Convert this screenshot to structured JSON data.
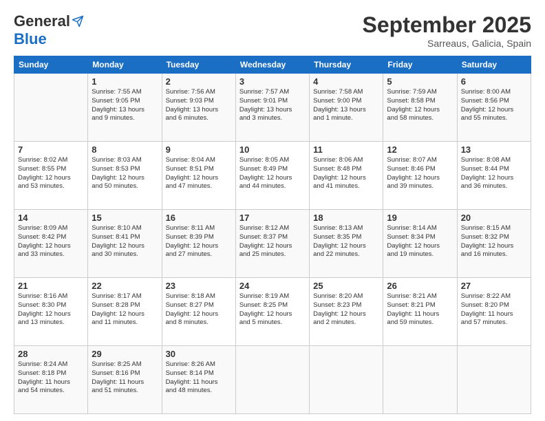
{
  "header": {
    "logo_general": "General",
    "logo_blue": "Blue",
    "month_title": "September 2025",
    "location": "Sarreaus, Galicia, Spain"
  },
  "weekdays": [
    "Sunday",
    "Monday",
    "Tuesday",
    "Wednesday",
    "Thursday",
    "Friday",
    "Saturday"
  ],
  "weeks": [
    [
      {
        "day": "",
        "info": ""
      },
      {
        "day": "1",
        "info": "Sunrise: 7:55 AM\nSunset: 9:05 PM\nDaylight: 13 hours\nand 9 minutes."
      },
      {
        "day": "2",
        "info": "Sunrise: 7:56 AM\nSunset: 9:03 PM\nDaylight: 13 hours\nand 6 minutes."
      },
      {
        "day": "3",
        "info": "Sunrise: 7:57 AM\nSunset: 9:01 PM\nDaylight: 13 hours\nand 3 minutes."
      },
      {
        "day": "4",
        "info": "Sunrise: 7:58 AM\nSunset: 9:00 PM\nDaylight: 13 hours\nand 1 minute."
      },
      {
        "day": "5",
        "info": "Sunrise: 7:59 AM\nSunset: 8:58 PM\nDaylight: 12 hours\nand 58 minutes."
      },
      {
        "day": "6",
        "info": "Sunrise: 8:00 AM\nSunset: 8:56 PM\nDaylight: 12 hours\nand 55 minutes."
      }
    ],
    [
      {
        "day": "7",
        "info": "Sunrise: 8:02 AM\nSunset: 8:55 PM\nDaylight: 12 hours\nand 53 minutes."
      },
      {
        "day": "8",
        "info": "Sunrise: 8:03 AM\nSunset: 8:53 PM\nDaylight: 12 hours\nand 50 minutes."
      },
      {
        "day": "9",
        "info": "Sunrise: 8:04 AM\nSunset: 8:51 PM\nDaylight: 12 hours\nand 47 minutes."
      },
      {
        "day": "10",
        "info": "Sunrise: 8:05 AM\nSunset: 8:49 PM\nDaylight: 12 hours\nand 44 minutes."
      },
      {
        "day": "11",
        "info": "Sunrise: 8:06 AM\nSunset: 8:48 PM\nDaylight: 12 hours\nand 41 minutes."
      },
      {
        "day": "12",
        "info": "Sunrise: 8:07 AM\nSunset: 8:46 PM\nDaylight: 12 hours\nand 39 minutes."
      },
      {
        "day": "13",
        "info": "Sunrise: 8:08 AM\nSunset: 8:44 PM\nDaylight: 12 hours\nand 36 minutes."
      }
    ],
    [
      {
        "day": "14",
        "info": "Sunrise: 8:09 AM\nSunset: 8:42 PM\nDaylight: 12 hours\nand 33 minutes."
      },
      {
        "day": "15",
        "info": "Sunrise: 8:10 AM\nSunset: 8:41 PM\nDaylight: 12 hours\nand 30 minutes."
      },
      {
        "day": "16",
        "info": "Sunrise: 8:11 AM\nSunset: 8:39 PM\nDaylight: 12 hours\nand 27 minutes."
      },
      {
        "day": "17",
        "info": "Sunrise: 8:12 AM\nSunset: 8:37 PM\nDaylight: 12 hours\nand 25 minutes."
      },
      {
        "day": "18",
        "info": "Sunrise: 8:13 AM\nSunset: 8:35 PM\nDaylight: 12 hours\nand 22 minutes."
      },
      {
        "day": "19",
        "info": "Sunrise: 8:14 AM\nSunset: 8:34 PM\nDaylight: 12 hours\nand 19 minutes."
      },
      {
        "day": "20",
        "info": "Sunrise: 8:15 AM\nSunset: 8:32 PM\nDaylight: 12 hours\nand 16 minutes."
      }
    ],
    [
      {
        "day": "21",
        "info": "Sunrise: 8:16 AM\nSunset: 8:30 PM\nDaylight: 12 hours\nand 13 minutes."
      },
      {
        "day": "22",
        "info": "Sunrise: 8:17 AM\nSunset: 8:28 PM\nDaylight: 12 hours\nand 11 minutes."
      },
      {
        "day": "23",
        "info": "Sunrise: 8:18 AM\nSunset: 8:27 PM\nDaylight: 12 hours\nand 8 minutes."
      },
      {
        "day": "24",
        "info": "Sunrise: 8:19 AM\nSunset: 8:25 PM\nDaylight: 12 hours\nand 5 minutes."
      },
      {
        "day": "25",
        "info": "Sunrise: 8:20 AM\nSunset: 8:23 PM\nDaylight: 12 hours\nand 2 minutes."
      },
      {
        "day": "26",
        "info": "Sunrise: 8:21 AM\nSunset: 8:21 PM\nDaylight: 11 hours\nand 59 minutes."
      },
      {
        "day": "27",
        "info": "Sunrise: 8:22 AM\nSunset: 8:20 PM\nDaylight: 11 hours\nand 57 minutes."
      }
    ],
    [
      {
        "day": "28",
        "info": "Sunrise: 8:24 AM\nSunset: 8:18 PM\nDaylight: 11 hours\nand 54 minutes."
      },
      {
        "day": "29",
        "info": "Sunrise: 8:25 AM\nSunset: 8:16 PM\nDaylight: 11 hours\nand 51 minutes."
      },
      {
        "day": "30",
        "info": "Sunrise: 8:26 AM\nSunset: 8:14 PM\nDaylight: 11 hours\nand 48 minutes."
      },
      {
        "day": "",
        "info": ""
      },
      {
        "day": "",
        "info": ""
      },
      {
        "day": "",
        "info": ""
      },
      {
        "day": "",
        "info": ""
      }
    ]
  ]
}
